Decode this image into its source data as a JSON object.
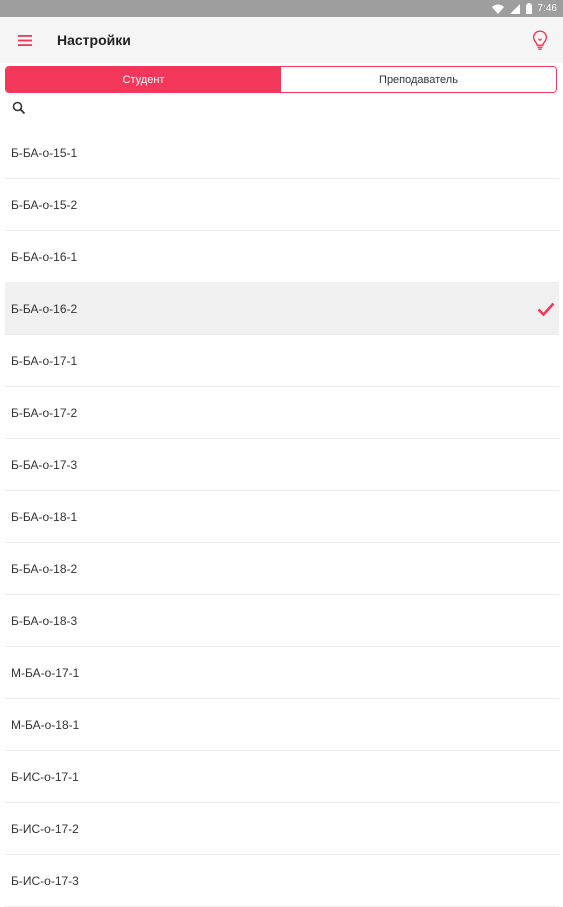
{
  "status": {
    "time": "7:46"
  },
  "appbar": {
    "title": "Настройки",
    "menu_icon": "hamburger-menu-icon",
    "action_icon": "lightbulb-icon"
  },
  "tabs": [
    {
      "label": "Студент",
      "active": true
    },
    {
      "label": "Преподаватель",
      "active": false
    }
  ],
  "search": {
    "icon": "search-icon"
  },
  "groups": [
    {
      "label": "Б-БА-о-15-1",
      "selected": false
    },
    {
      "label": "Б-БА-о-15-2",
      "selected": false
    },
    {
      "label": "Б-БА-о-16-1",
      "selected": false
    },
    {
      "label": "Б-БА-о-16-2",
      "selected": true
    },
    {
      "label": "Б-БА-о-17-1",
      "selected": false
    },
    {
      "label": "Б-БА-о-17-2",
      "selected": false
    },
    {
      "label": "Б-БА-о-17-3",
      "selected": false
    },
    {
      "label": "Б-БА-о-18-1",
      "selected": false
    },
    {
      "label": "Б-БА-о-18-2",
      "selected": false
    },
    {
      "label": "Б-БА-о-18-3",
      "selected": false
    },
    {
      "label": "М-БА-о-17-1",
      "selected": false
    },
    {
      "label": "М-БА-о-18-1",
      "selected": false
    },
    {
      "label": "Б-ИС-о-17-1",
      "selected": false
    },
    {
      "label": "Б-ИС-о-17-2",
      "selected": false
    },
    {
      "label": "Б-ИС-о-17-3",
      "selected": false
    }
  ],
  "colors": {
    "accent": "#f2375a",
    "statusbar": "#9e9e9e",
    "appbar": "#f5f5f5",
    "selected_row": "#f0f0f0"
  }
}
